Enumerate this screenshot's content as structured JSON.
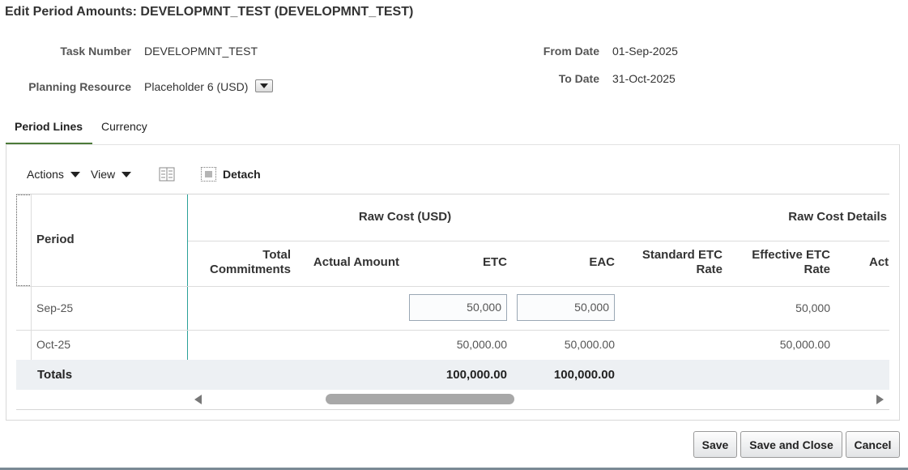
{
  "page": {
    "title": "Edit Period Amounts: DEVELOPMNT_TEST (DEVELOPMNT_TEST)"
  },
  "form": {
    "task_number_label": "Task Number",
    "task_number_value": "DEVELOPMNT_TEST",
    "planning_resource_label": "Planning Resource",
    "planning_resource_value": "Placeholder 6 (USD)",
    "from_date_label": "From Date",
    "from_date_value": "01-Sep-2025",
    "to_date_label": "To Date",
    "to_date_value": "31-Oct-2025"
  },
  "tabs": [
    {
      "label": "Period Lines",
      "active": true
    },
    {
      "label": "Currency",
      "active": false
    }
  ],
  "toolbar": {
    "actions_label": "Actions",
    "view_label": "View",
    "detach_label": "Detach"
  },
  "table": {
    "period_header": "Period",
    "group_raw_cost": "Raw Cost (USD)",
    "group_raw_cost_details": "Raw Cost Details",
    "columns": {
      "total_commitments": [
        "Total",
        "Commitments"
      ],
      "actual_amount": "Actual Amount",
      "etc": "ETC",
      "eac": "EAC",
      "standard_etc_rate": [
        "Standard ETC",
        "Rate"
      ],
      "effective_etc_rate": [
        "Effective ETC",
        "Rate"
      ],
      "actual_partial": "Act"
    },
    "rows": [
      {
        "period": "Sep-25",
        "etc": "50,000",
        "eac": "50,000",
        "effective_etc_rate": "50,000"
      },
      {
        "period": "Oct-25",
        "etc": "50,000.00",
        "eac": "50,000.00",
        "effective_etc_rate": "50,000.00"
      }
    ],
    "totals": {
      "label": "Totals",
      "etc": "100,000.00",
      "eac": "100,000.00"
    }
  },
  "buttons": {
    "save": "Save",
    "save_and_close": "Save and Close",
    "cancel": "Cancel"
  },
  "icons": {
    "freeze": "freeze-columns-icon",
    "detach": "detach-icon",
    "dropdown": "chevron-down-icon"
  },
  "colors": {
    "tab_underline": "#4d7a3a",
    "frozen_divider": "#2aa198",
    "totals_bg": "#edf0f3"
  }
}
